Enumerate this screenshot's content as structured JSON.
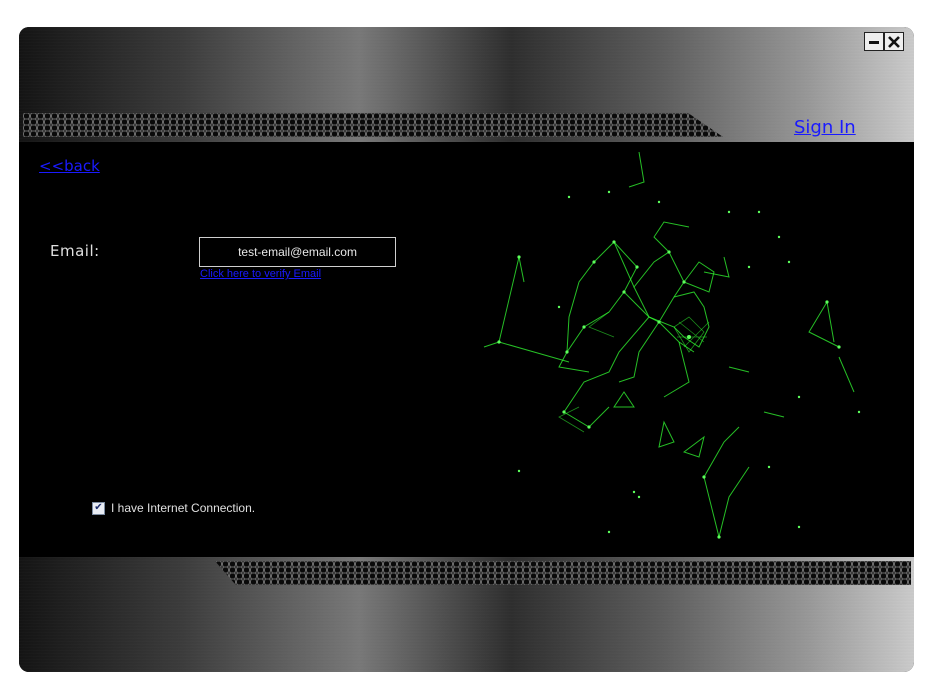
{
  "header": {
    "sign_in_label": "Sign In",
    "minimize_icon": "minimize-icon",
    "close_icon": "close-icon"
  },
  "nav": {
    "back_label": "<<back"
  },
  "form": {
    "email_label": "Email:",
    "email_value": "test-email@email.com",
    "verify_link_label": "Click here to verify Email"
  },
  "options": {
    "internet_label": "I have Internet Connection.",
    "internet_checked": true
  },
  "colors": {
    "accent_link": "#1a1aff",
    "network_green": "#33ff33",
    "background": "#000000"
  }
}
